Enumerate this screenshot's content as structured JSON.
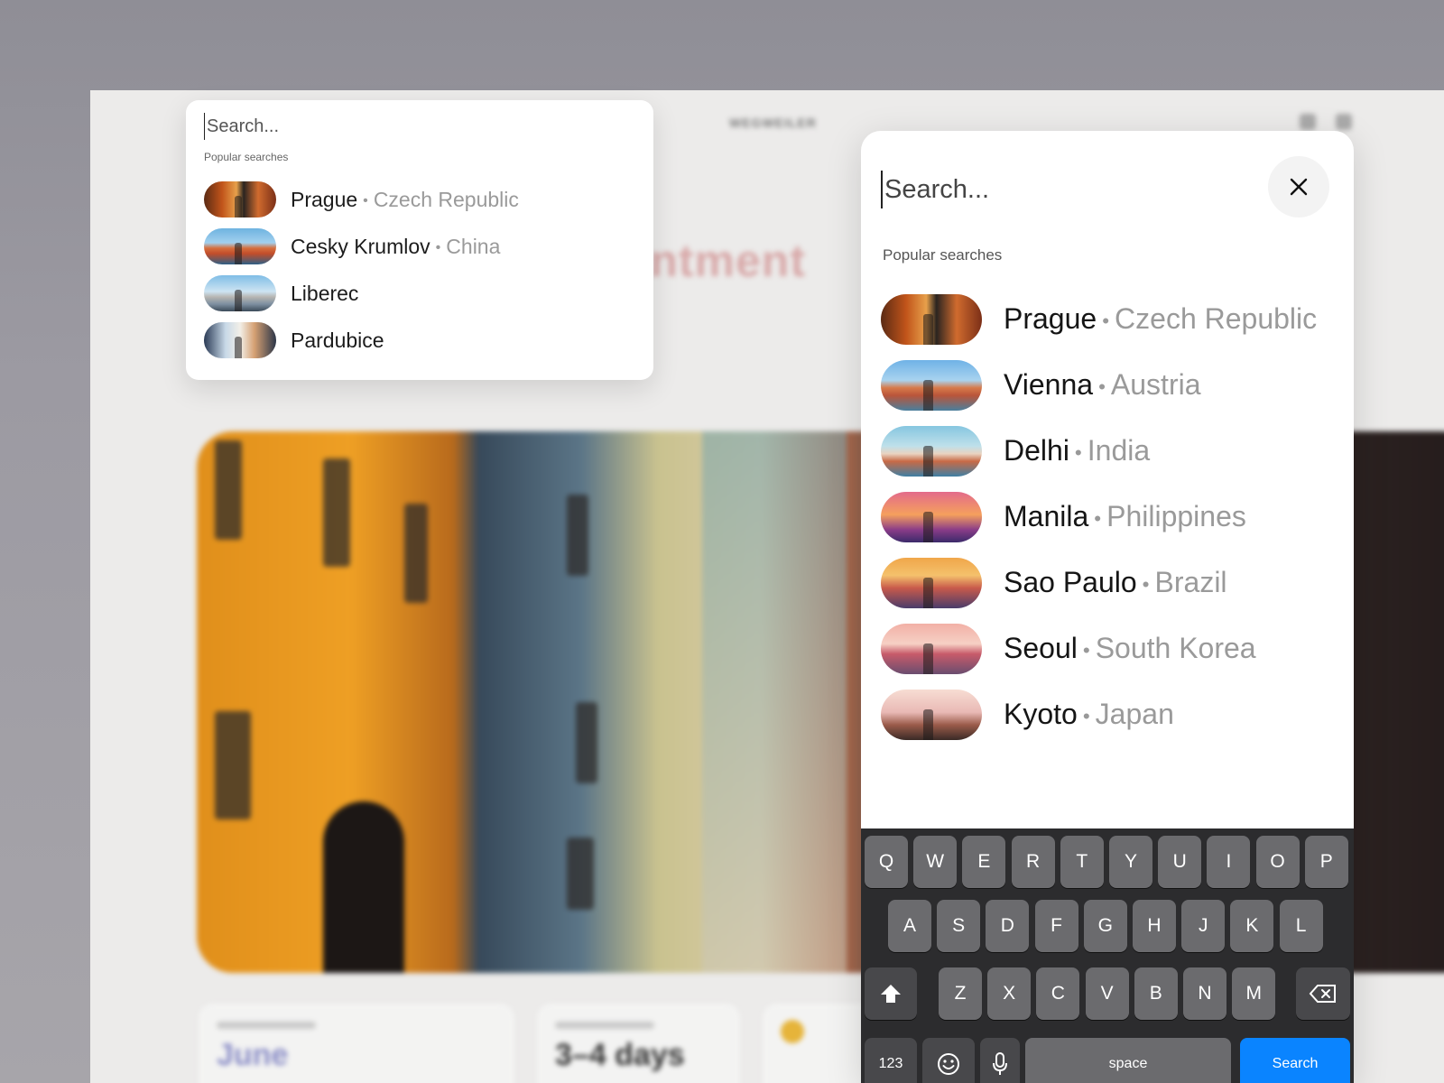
{
  "background": {
    "brand": "WEGWEILER",
    "headline": "hantment",
    "cards": [
      {
        "value": "June",
        "color": "#8b8ec7"
      },
      {
        "value": "3–4 days",
        "color": "#333333"
      }
    ]
  },
  "small_search": {
    "placeholder": "Search...",
    "section_title": "Popular searches",
    "items": [
      {
        "city": "Prague",
        "country": "Czech Republic",
        "thumb": "t-prague"
      },
      {
        "city": "Cesky Krumlov",
        "country": "China",
        "thumb": "t-krumlov"
      },
      {
        "city": "Liberec",
        "country": "",
        "thumb": "t-liberec"
      },
      {
        "city": "Pardubice",
        "country": "",
        "thumb": "t-pardubice"
      }
    ]
  },
  "panel": {
    "placeholder": "Search...",
    "close_icon": "close-icon",
    "section_title": "Popular searches",
    "items": [
      {
        "city": "Prague",
        "country": "Czech Republic",
        "thumb": "t-prague"
      },
      {
        "city": "Vienna",
        "country": "Austria",
        "thumb": "t-vienna"
      },
      {
        "city": "Delhi",
        "country": "India",
        "thumb": "t-delhi"
      },
      {
        "city": "Manila",
        "country": "Philippines",
        "thumb": "t-manila"
      },
      {
        "city": "Sao Paulo",
        "country": "Brazil",
        "thumb": "t-saopaulo"
      },
      {
        "city": "Seoul",
        "country": "South Korea",
        "thumb": "t-seoul"
      },
      {
        "city": "Kyoto",
        "country": "Japan",
        "thumb": "t-kyoto"
      }
    ]
  },
  "keyboard": {
    "row1": [
      "Q",
      "W",
      "E",
      "R",
      "T",
      "Y",
      "U",
      "I",
      "O",
      "P"
    ],
    "row2": [
      "A",
      "S",
      "D",
      "F",
      "G",
      "H",
      "J",
      "K",
      "L"
    ],
    "row3": [
      "Z",
      "X",
      "C",
      "V",
      "B",
      "N",
      "M"
    ],
    "numbers_label": "123",
    "space_label": "space",
    "search_label": "Search",
    "icons": {
      "shift": "shift-icon",
      "backspace": "backspace-icon",
      "emoji": "emoji-icon",
      "mic": "microphone-icon"
    },
    "accent_color": "#0a84ff"
  }
}
